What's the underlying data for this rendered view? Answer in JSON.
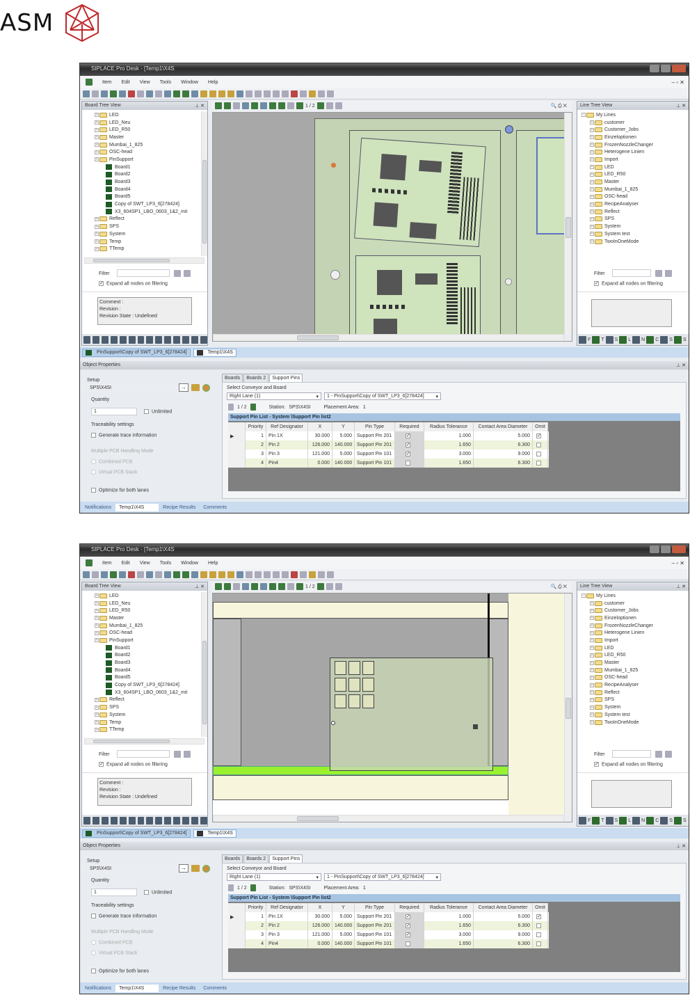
{
  "logo": {
    "text": "ASM",
    "color": "#c0282a"
  },
  "app": {
    "title": "SIPLACE Pro Desk - [Temp1\\X4S",
    "menu": [
      "Item",
      "Edit",
      "View",
      "Tools",
      "Window",
      "Help"
    ],
    "board_tree": {
      "title": "Board Tree View",
      "items": [
        {
          "label": "LED",
          "type": "folder",
          "level": 1
        },
        {
          "label": "LED_Neu",
          "type": "folder",
          "level": 1
        },
        {
          "label": "LED_R50",
          "type": "folder",
          "level": 1
        },
        {
          "label": "Master",
          "type": "folder",
          "level": 1
        },
        {
          "label": "Mumbai_1_825",
          "type": "folder",
          "level": 1
        },
        {
          "label": "OSC-head",
          "type": "folder",
          "level": 1
        },
        {
          "label": "PinSupport",
          "type": "folder",
          "level": 1
        },
        {
          "label": "Board1",
          "type": "board",
          "level": 2
        },
        {
          "label": "Board2",
          "type": "board",
          "level": 2
        },
        {
          "label": "Board3",
          "type": "board",
          "level": 2
        },
        {
          "label": "Board4",
          "type": "board",
          "level": 2
        },
        {
          "label": "Board5",
          "type": "board",
          "level": 2
        },
        {
          "label": "Copy of SWT_LP3_6[278424]",
          "type": "board",
          "level": 2
        },
        {
          "label": "X3_604SP1_LBO_0603_1&2_mit",
          "type": "board",
          "level": 2
        },
        {
          "label": "Reflect",
          "type": "folder",
          "level": 1
        },
        {
          "label": "SPS",
          "type": "folder",
          "level": 1
        },
        {
          "label": "System",
          "type": "folder",
          "level": 1
        },
        {
          "label": "Temp",
          "type": "folder",
          "level": 1
        },
        {
          "label": "TTemp",
          "type": "folder",
          "level": 1
        }
      ],
      "filter_label": "Filter",
      "filter_value": "",
      "expand_label": "Expand all nodes on filtering",
      "comment_lines": [
        "Comment :",
        "Revision :",
        "Revision State : Undefined"
      ]
    },
    "line_tree": {
      "title": "Line Tree View",
      "root": "My Lines",
      "items": [
        "customer",
        "Customer_Jobs",
        "Einzeloptionen",
        "FrozenNozzleChanger",
        "Heterogene Linien",
        "Import",
        "LED",
        "LED_R50",
        "Master",
        "Mumbai_1_825",
        "OSC-head",
        "RecipeAnalyser",
        "Reflect",
        "SPS",
        "System",
        "System test",
        "TwoInOneMode"
      ],
      "filter_label": "Filter",
      "expand_label": "Expand all nodes on filtering",
      "icon_letters": [
        "F",
        "T",
        "S",
        "L",
        "N",
        "C",
        "S",
        "S"
      ]
    },
    "canvas_toolbar": {
      "page": "1 / 2"
    },
    "doc_tabs": [
      "PinSupport\\Copy of SWT_LP3_6[278424]",
      "Temp1\\X4S"
    ],
    "object_properties": {
      "title": "Object Properties",
      "setup_label": "Setup",
      "setup_value": "SPS\\X4SI",
      "quantity_label": "Quantity",
      "quantity_value": "1",
      "unlimited_label": "Unlimited",
      "traceability_label": "Traceability settings",
      "generate_trace_label": "Generate trace information",
      "multi_pcb_label": "Multiple PCB Handling Mode",
      "combined_pcb_label": "Combined PCB",
      "virtual_pcb_label": "Virtual PCB Stack",
      "optimize_label": "Optimize for both lanes",
      "tabs": [
        "Boards",
        "Boards 2",
        "Support Pins"
      ],
      "select_label": "Select Conveyor and Board",
      "conveyor_value": "Right Lane (1)",
      "board_value": "1 - PinSupport\\Copy of SWT_LP3_6[278424]",
      "page": "1 / 2",
      "station_label": "Station:",
      "station_value": "SPS\\X4SI",
      "placement_area_label": "Placement Area:",
      "placement_area_value": "1",
      "grid_title": "Support Pin List - System \\Support Pin list2",
      "columns": [
        "Priority",
        "Ref Designator",
        "X",
        "Y",
        "Pin Type",
        "Required",
        "Radius Tolerance",
        "Contact Area Diameter",
        "Omit"
      ],
      "rows": [
        {
          "priority": "1",
          "ref": "Pin 1X",
          "x": "30.000",
          "y": "5.000",
          "pin_type": "Support Pin 201",
          "required": true,
          "radius": "1.000",
          "contact": "5.000",
          "omit": true
        },
        {
          "priority": "2",
          "ref": "Pin 2",
          "x": "126.000",
          "y": "140.000",
          "pin_type": "Support Pin 201",
          "required": true,
          "radius": "1.650",
          "contact": "6.300",
          "omit": false
        },
        {
          "priority": "3",
          "ref": "Pin 3",
          "x": "121.000",
          "y": "5.000",
          "pin_type": "Support Pin 101",
          "required": true,
          "radius": "3.000",
          "contact": "9.000",
          "omit": false
        },
        {
          "priority": "4",
          "ref": "Pin4",
          "x": "0.000",
          "y": "140.000",
          "pin_type": "Support Pin 101",
          "required": false,
          "radius": "1.650",
          "contact": "6.300",
          "omit": false
        }
      ]
    },
    "bottom_tabs": [
      "Notifications",
      "Temp1\\X4S",
      "Recipe Results",
      "Comments"
    ]
  },
  "screens": [
    {
      "canvas": "boards"
    },
    {
      "canvas": "conveyor"
    }
  ]
}
